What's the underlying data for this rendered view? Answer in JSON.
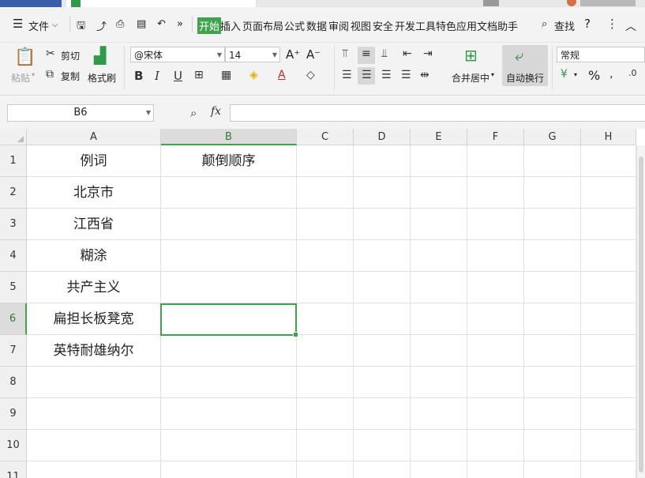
{
  "menubar": {
    "file": "文件",
    "tabs": [
      "开始",
      "插入",
      "页面布局",
      "公式",
      "数据",
      "审阅",
      "视图",
      "安全",
      "开发工具",
      "特色应用",
      "文档助手"
    ],
    "search": "查找"
  },
  "ribbon": {
    "paste": "粘贴",
    "cut": "剪切",
    "copy": "复制",
    "format_painter": "格式刷",
    "font_name": "@宋体",
    "font_size": "14",
    "grow_font": "A⁺",
    "shrink_font": "A⁻",
    "merge_center": "合并居中",
    "wrap_text": "自动换行",
    "number_format": "常规",
    "percent": "%"
  },
  "formula_bar": {
    "name_box": "B6",
    "fx": "fx",
    "content": ""
  },
  "grid": {
    "columns": [
      "A",
      "B",
      "C",
      "D",
      "E",
      "F",
      "G",
      "H"
    ],
    "selected_column": "B",
    "rows": [
      "1",
      "2",
      "3",
      "4",
      "5",
      "6",
      "7",
      "8",
      "9",
      "10",
      "11"
    ],
    "selected_row": "6",
    "cells": [
      {
        "a": "例词",
        "b": "颠倒顺序"
      },
      {
        "a": "北京市",
        "b": ""
      },
      {
        "a": "江西省",
        "b": ""
      },
      {
        "a": "糊涂",
        "b": ""
      },
      {
        "a": "共产主义",
        "b": ""
      },
      {
        "a": "扁担长板凳宽",
        "b": ""
      },
      {
        "a": "英特耐雄纳尔",
        "b": ""
      }
    ]
  },
  "colors": {
    "accent": "#3fa34d",
    "toolbar_bg": "#f3f3f3",
    "header_bg": "#f0f0f0"
  }
}
